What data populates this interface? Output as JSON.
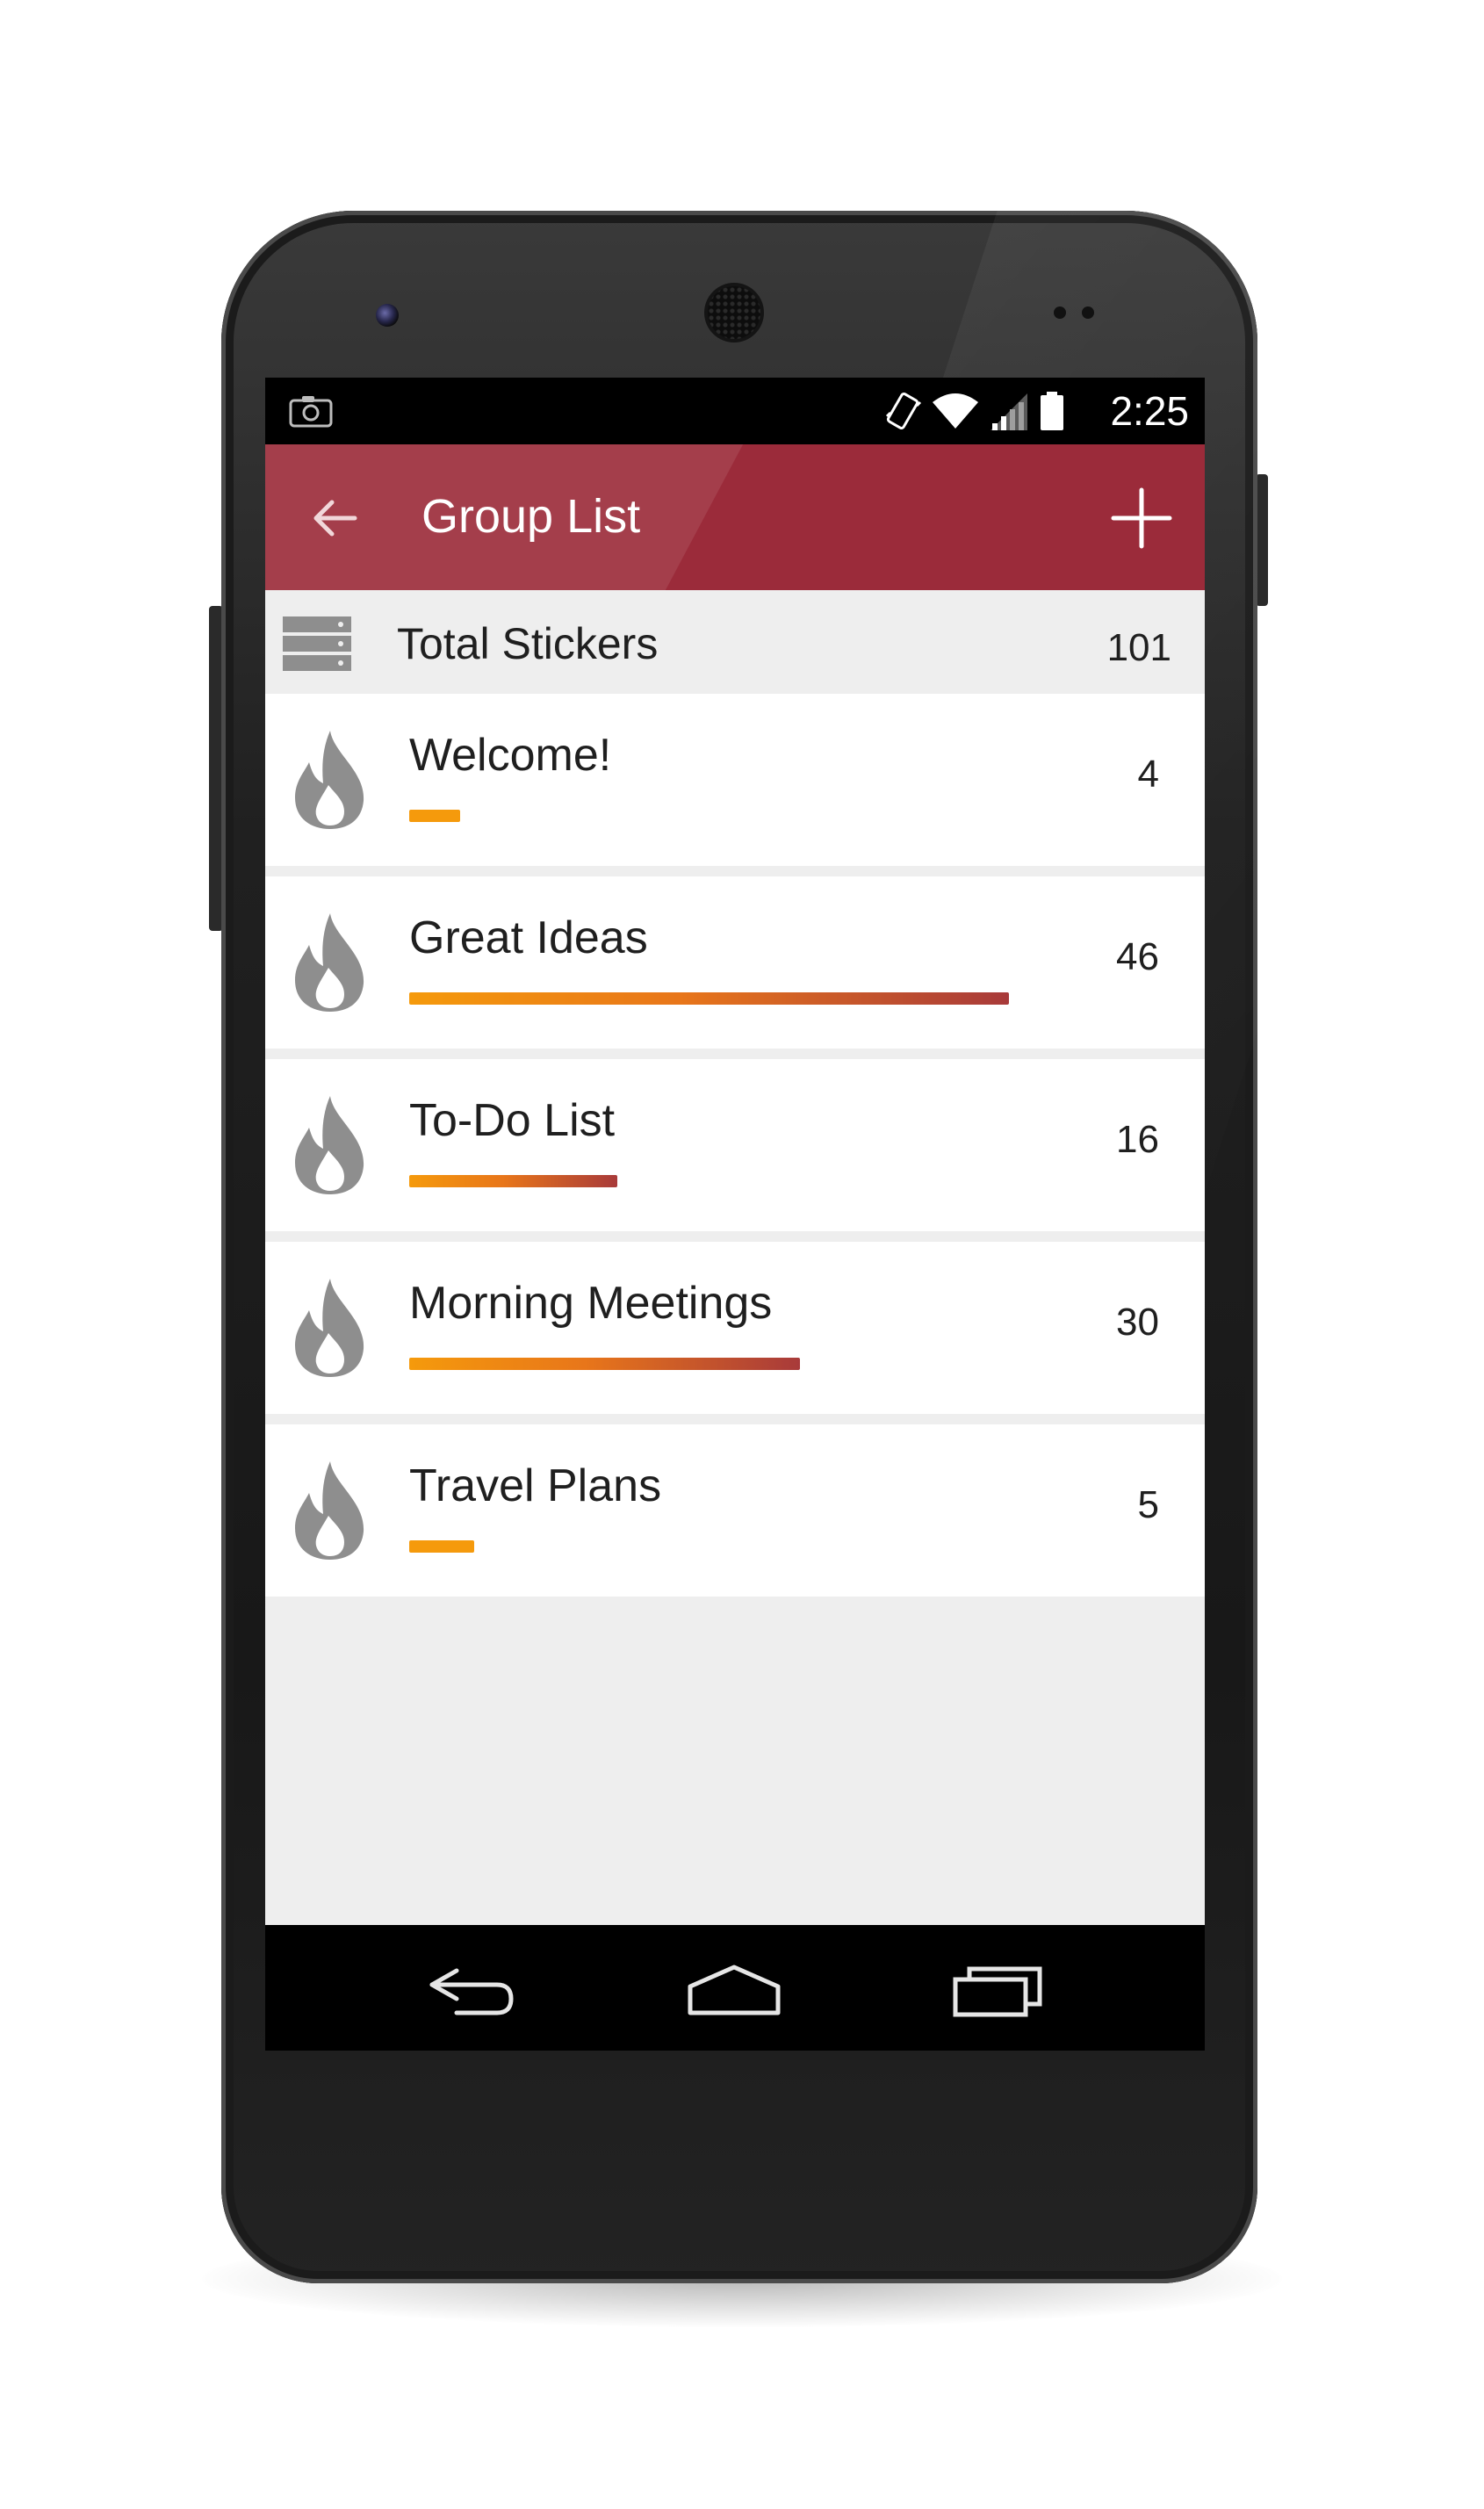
{
  "status_bar": {
    "time": "2:25",
    "icons": [
      "screenshot-icon",
      "vibrate-icon",
      "wifi-icon",
      "signal-icon",
      "battery-icon"
    ]
  },
  "app_bar": {
    "title": "Group List",
    "back_icon": "arrow-left-icon",
    "add_icon": "plus-icon",
    "color": "#9b2b3a"
  },
  "total": {
    "label": "Total Stickers",
    "count": "101",
    "icon": "database-icon"
  },
  "groups": [
    {
      "name": "Welcome!",
      "count": "4",
      "icon": "flame-icon"
    },
    {
      "name": "Great Ideas",
      "count": "46",
      "icon": "flame-icon"
    },
    {
      "name": "To-Do List",
      "count": "16",
      "icon": "flame-icon"
    },
    {
      "name": "Morning Meetings",
      "count": "30",
      "icon": "flame-icon"
    },
    {
      "name": "Travel Plans",
      "count": "5",
      "icon": "flame-icon"
    }
  ],
  "nav_bar": {
    "icons": [
      "nav-back-icon",
      "nav-home-icon",
      "nav-recents-icon"
    ]
  },
  "colors": {
    "accent": "#9b2b3a",
    "bar_start": "#f59a0c",
    "bar_end": "#a83a3a",
    "icon_gray": "#8e8e8e"
  }
}
